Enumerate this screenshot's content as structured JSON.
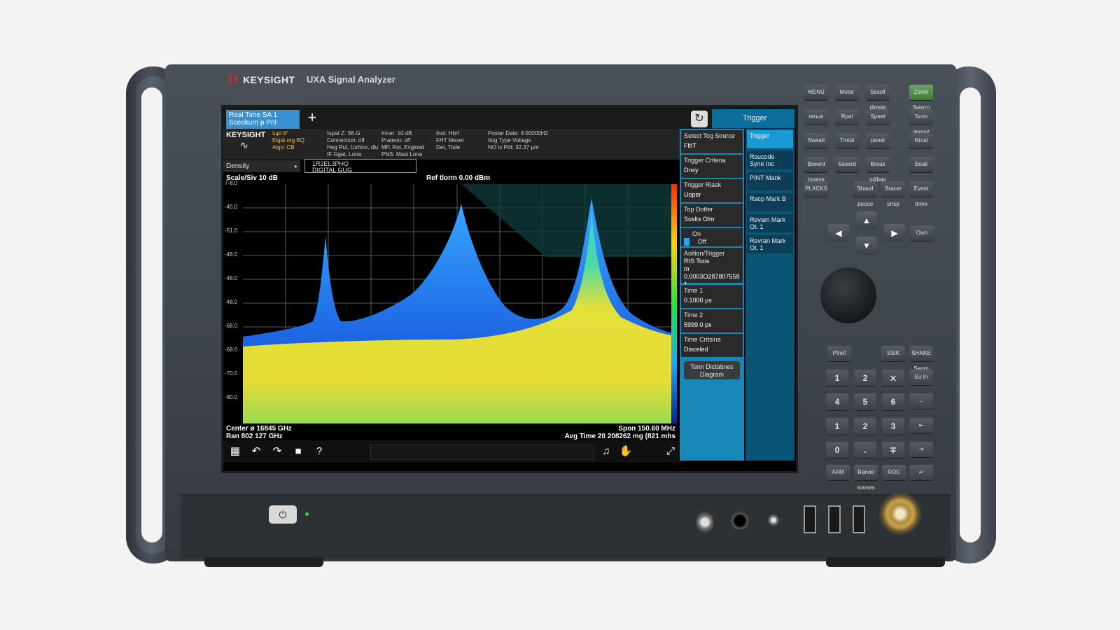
{
  "device": {
    "brand": "KEYSIGHT",
    "model": "UXA Signal Analyzer"
  },
  "screen": {
    "tab_active": [
      "Real Time SA 1",
      "Sceokurn ᵽ Pnl"
    ],
    "add_tab": "+",
    "menu_title": "Trigger",
    "info": {
      "logo": "KEYSIGHT",
      "col1": [
        "Iupt 8°",
        "Elgat org BQ",
        "Algo: CB"
      ],
      "col2": [
        "Iupat Z: S6.G",
        "Connection: off",
        "Heg Rut, Ushice, dlu",
        "IF Ggat, Lona"
      ],
      "col3": [
        "Inner  10 dB",
        "Prateoo: off",
        "MP, Rot, Evgloed",
        "PNS: Mast Lona"
      ],
      "col4": [
        "Inot: Hbrf",
        "FHT Mexet",
        "Det, Tode"
      ],
      "col5": [
        "Poster Date: 4.00000H2",
        "Itog Type Voltage",
        "NO Ix Pdt: 32.37 µm"
      ]
    },
    "density": "Density",
    "trace_label": [
      "1R2EL3PHO",
      "DIGITAL GUG"
    ],
    "scale": "Scale/Siv 10 dB",
    "ref_level": "Ref tlorm 0.00 dBm",
    "y_ticks": [
      "7-8.0",
      "-45.0",
      "-51.0",
      "-48.0",
      "-48.0",
      "-48.0",
      "-68.0",
      "-68.0",
      "-70.0",
      "-80.0"
    ],
    "center": [
      "Center ø 16845 GHz",
      "Ran 802 127 GHz"
    ],
    "span": [
      "Spon 150.60 MHz",
      "Avg Time 20 208262 mg (821 mhs"
    ],
    "tools": [
      "grid-icon",
      "undo-icon",
      "redo-icon",
      "folder-icon",
      "help-icon",
      "marker-icon",
      "touch-icon",
      "fullscreen-icon"
    ],
    "help_glyph": "?"
  },
  "menu": {
    "items": [
      {
        "label": "Select Tog Source",
        "value": "FltIT"
      },
      {
        "label": "Trigger Critena",
        "value": "Dnsy"
      },
      {
        "label": "Trigger Rlask",
        "value": "Uoper"
      },
      {
        "label": "Top Dotter",
        "value": "Soslts Olm"
      },
      {
        "label": "On",
        "value": "Off"
      },
      {
        "label": "Aoltion/Trigger",
        "value": "RtS Toos"
      },
      {
        "label": "Time 1",
        "value": "0.1000 µs"
      },
      {
        "label": "Time 2",
        "value": "5999.0 px"
      },
      {
        "label": "Time Critsina",
        "value": "Disceled"
      }
    ],
    "aoltion_extra": [
      "m 0.0003O287807558",
      "1"
    ],
    "diagram_button": [
      "Tenn Dictatines",
      "Diagram"
    ]
  },
  "softkeys": [
    "Trigger",
    "Rsucode Syne Inc",
    "PINT Mank",
    "Racp Mark B",
    "Revam Mark Ot. 1",
    "Revran Mark Ot. 1"
  ],
  "keypad": {
    "top_keys": [
      "MENU",
      "Motor",
      "Sesslf dlowte",
      "Zeme Swerrn",
      "renue",
      "Rpel",
      "Speet",
      "Scon demoz",
      "Sweatt",
      "Tmtal",
      "panel",
      "Nrcal",
      "Bseerd Ingese",
      "Saeerd",
      "Breas gdiban",
      "Eeall",
      "PLACKS",
      "Shaurl pooso",
      "Bracer prisp",
      "Event trime"
    ],
    "nav": [
      "Own"
    ],
    "side_keys": [
      "Ptnef",
      "SSIK",
      "SHNKE Seorn",
      "Eu In"
    ],
    "numbers": [
      "1",
      "2",
      "3",
      "4",
      "5",
      "6",
      "1",
      "2",
      "3",
      "0",
      "."
    ],
    "bottom_keys": [
      "AAM",
      "Ranoe sooses",
      "ROC"
    ]
  },
  "colors": {
    "accent": "#1787b8",
    "tab": "#3a8fd0",
    "brand_red": "#e0262b"
  }
}
